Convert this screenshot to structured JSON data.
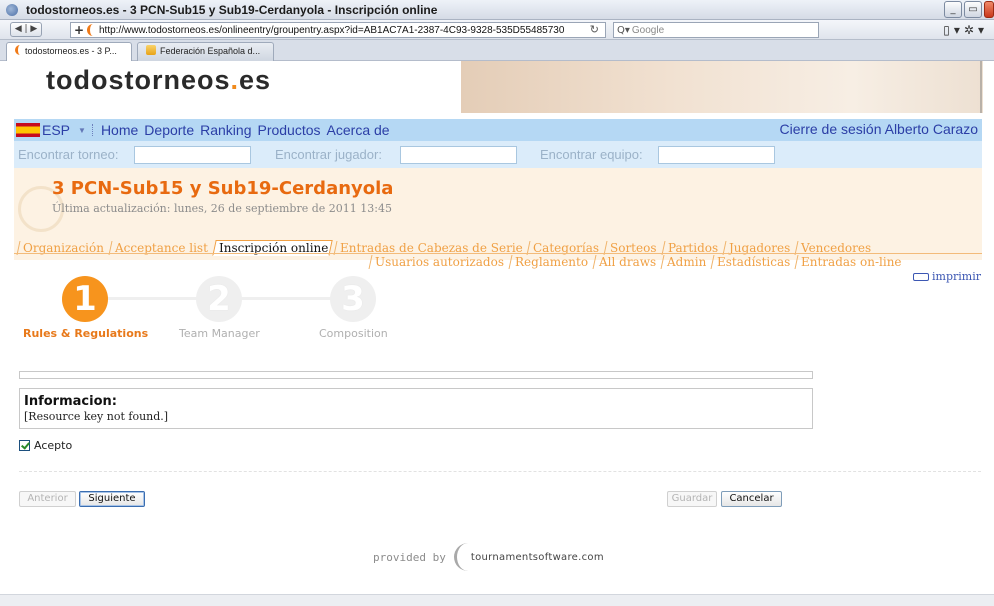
{
  "browser": {
    "window_title": "todostorneos.es - 3 PCN-Sub15 y Sub19-Cerdanyola - Inscripción online",
    "url": "http://www.todostorneos.es/onlineentry/groupentry.aspx?id=AB1AC7A1-2387-4C93-9328-535D55485730",
    "search_placeholder": "Google",
    "tabs": [
      {
        "label": "todostorneos.es - 3 P..."
      },
      {
        "label": "Federación Española d..."
      }
    ]
  },
  "site": {
    "logo_text": "todostorneos",
    "logo_dot": ".",
    "logo_suffix": "es"
  },
  "menu": {
    "language": "ESP",
    "items": [
      "Home",
      "Deporte",
      "Ranking",
      "Productos",
      "Acerca de"
    ],
    "logout": "Cierre de sesión",
    "user": "Alberto Carazo"
  },
  "search": {
    "tournament_label": "Encontrar torneo:",
    "player_label": "Encontrar jugador:",
    "team_label": "Encontrar equipo:"
  },
  "tournament": {
    "name": "3 PCN-Sub15 y Sub19-Cerdanyola",
    "updated": "Última actualización: lunes, 26 de septiembre de 2011 13:45"
  },
  "tabs_row1": [
    "Organización",
    "Acceptance list",
    "Inscripción online",
    "Entradas de Cabezas de Serie",
    "Categorías",
    "Sorteos",
    "Partidos",
    "Jugadores",
    "Vencedores"
  ],
  "tabs_row1_active": "Inscripción online",
  "tabs_row2": [
    "Usuarios autorizados",
    "Reglamento",
    "All draws",
    "Admin",
    "Estadísticas",
    "Entradas on-line"
  ],
  "print_label": "imprimir",
  "steps": [
    {
      "number": "1",
      "label": "Rules & Regulations",
      "active": true
    },
    {
      "number": "2",
      "label": "Team Manager",
      "active": false
    },
    {
      "number": "3",
      "label": "Composition",
      "active": false
    }
  ],
  "info": {
    "title": "Informacion:",
    "text": "[Resource key not found.]"
  },
  "accept": {
    "label": "Acepto",
    "checked": true
  },
  "buttons": {
    "previous": "Anterior",
    "next": "Siguiente",
    "save": "Guardar",
    "cancel": "Cancelar"
  },
  "footer": {
    "provided_by": "provided by",
    "provider": "tournamentsoftware.com"
  },
  "colors": {
    "accent_orange": "#f7941d",
    "menu_blue": "#b5d8f4",
    "link_blue": "#2b3ea6"
  }
}
